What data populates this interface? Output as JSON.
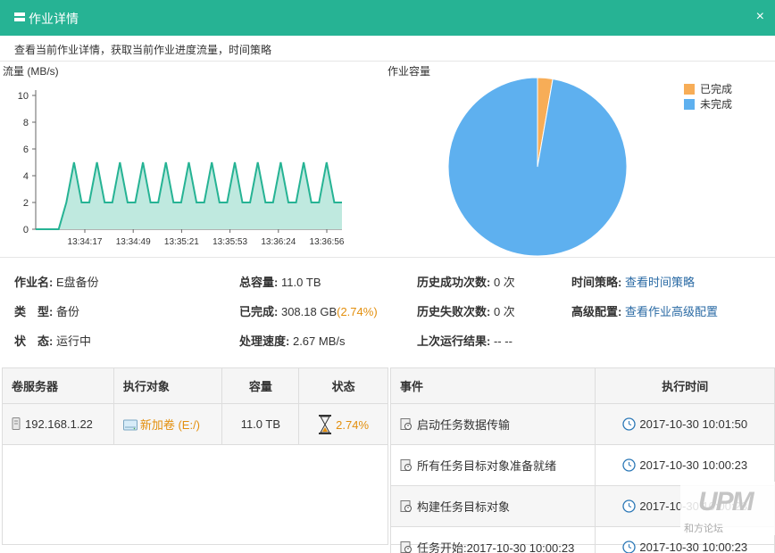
{
  "window": {
    "title": "作业详情",
    "close_label": "×"
  },
  "subtitle": "查看当前作业详情，获取当前作业进度流量，时间策略",
  "flow_chart_label": "流量 (MB/s)",
  "pie_chart_label": "作业容量",
  "chart_data": [
    {
      "type": "area",
      "ylabel": "流量 (MB/s)",
      "ylim": [
        0,
        10
      ],
      "yticks": [
        "0",
        "2",
        "4",
        "6",
        "8",
        "10"
      ],
      "xticks": [
        "13:34:17",
        "13:34:49",
        "13:35:21",
        "13:35:53",
        "13:36:24",
        "13:36:56"
      ],
      "series": [
        {
          "values": [
            0,
            0,
            0,
            0,
            2,
            5,
            2,
            2,
            5,
            2,
            2,
            5,
            2,
            2,
            5,
            2,
            2,
            5,
            2,
            2,
            5,
            2,
            2,
            5,
            2,
            2,
            5,
            2,
            2,
            5,
            2,
            2,
            5,
            2,
            2,
            5,
            2,
            2,
            5,
            2,
            2
          ]
        }
      ],
      "color": "#26b394"
    },
    {
      "type": "pie",
      "legend": [
        "已完成",
        "未完成"
      ],
      "values": [
        2.74,
        97.26
      ],
      "colors": [
        "#f7ad57",
        "#5eb0ef"
      ],
      "legend_position": "top-right"
    }
  ],
  "info": {
    "job_name_label": "作业名:",
    "job_name": "E盘备份",
    "type_label": "类　型:",
    "type": "备份",
    "status_label": "状　态:",
    "status": "运行中",
    "total_label": "总容量:",
    "total": "11.0 TB",
    "done_label": "已完成:",
    "done": "308.18 GB",
    "done_pct": "(2.74%)",
    "speed_label": "处理速度:",
    "speed": "2.67 MB/s",
    "success_label": "历史成功次数:",
    "success": "0 次",
    "fail_label": "历史失败次数:",
    "fail": "0 次",
    "last_label": "上次运行结果:",
    "last": "-- --",
    "policy_label": "时间策略:",
    "policy_link": "查看时间策略",
    "advanced_label": "高级配置:",
    "advanced_link": "查看作业高级配置"
  },
  "volume_table": {
    "headers": [
      "卷服务器",
      "执行对象",
      "容量",
      "状态"
    ],
    "rows": [
      {
        "server": "192.168.1.22",
        "object": "新加卷 (E:/)",
        "capacity": "11.0 TB",
        "status": "2.74%"
      }
    ]
  },
  "event_table": {
    "headers": [
      "事件",
      "执行时间"
    ],
    "rows": [
      {
        "event": "启动任务数据传输",
        "time": "2017-10-30 10:01:50"
      },
      {
        "event": "所有任务目标对象准备就绪",
        "time": "2017-10-30 10:00:23"
      },
      {
        "event": "构建任务目标对象",
        "time": "2017-10-30 10:00:23"
      },
      {
        "event": "任务开始:2017-10-30 10:00:23",
        "time": "2017-10-30 10:00:23"
      }
    ]
  },
  "watermark": {
    "logo": "UPM",
    "text": "和方论坛"
  },
  "colors": {
    "accent": "#26b394",
    "orange": "#e38f0d",
    "link": "#2a6aa4"
  }
}
